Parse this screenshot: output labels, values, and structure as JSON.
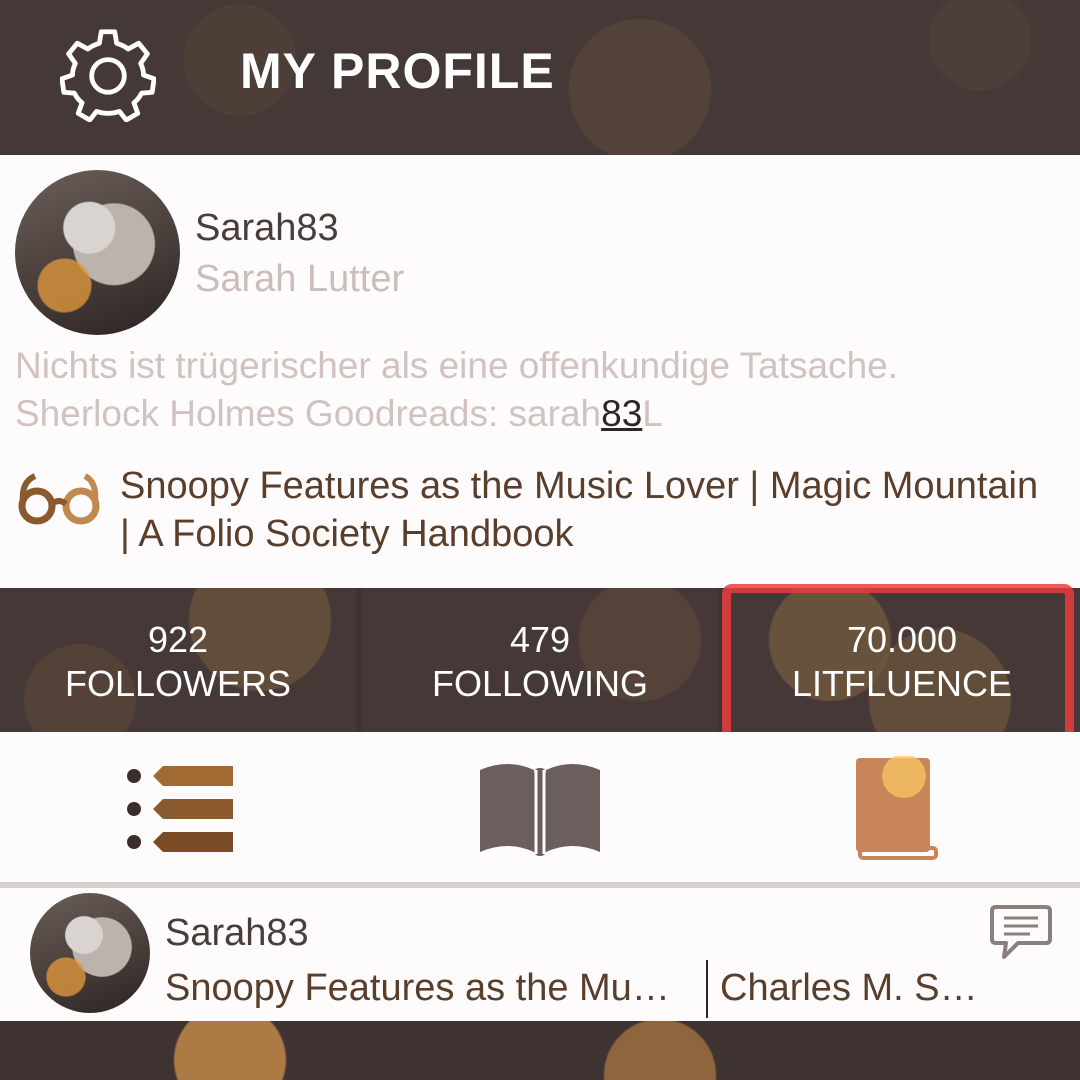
{
  "header": {
    "title": "MY PROFILE",
    "settings_icon": "gear-icon"
  },
  "profile": {
    "username": "Sarah83",
    "full_name": "Sarah Lutter",
    "bio_line1": "Nichts ist trügerischer als eine offenkundige Tatsache.",
    "bio_line2_prefix": "Sherlock Holmes Goodreads: sarah",
    "bio_link": "83",
    "bio_line2_suffix": "L",
    "currently_reading_icon": "reading-glasses-icon",
    "currently_reading": "Snoopy Features as the Music Lover | Magic Mountain | A Folio Society Handbook"
  },
  "stats": [
    {
      "value": "922",
      "label": "FOLLOWERS"
    },
    {
      "value": "479",
      "label": "FOLLOWING"
    },
    {
      "value": "70.000",
      "label": "LITFLUENCE"
    }
  ],
  "tabs": [
    {
      "icon": "list-icon"
    },
    {
      "icon": "open-book-icon"
    },
    {
      "icon": "closed-book-icon"
    }
  ],
  "feed": {
    "username": "Sarah83",
    "book_title": "Snoopy Features as the Mu…",
    "author": "Charles M. S…",
    "comment_icon": "comment-icon"
  },
  "colors": {
    "header_bg": "#463a38",
    "accent": "#c08a4e",
    "highlight": "#eb3c3c"
  }
}
